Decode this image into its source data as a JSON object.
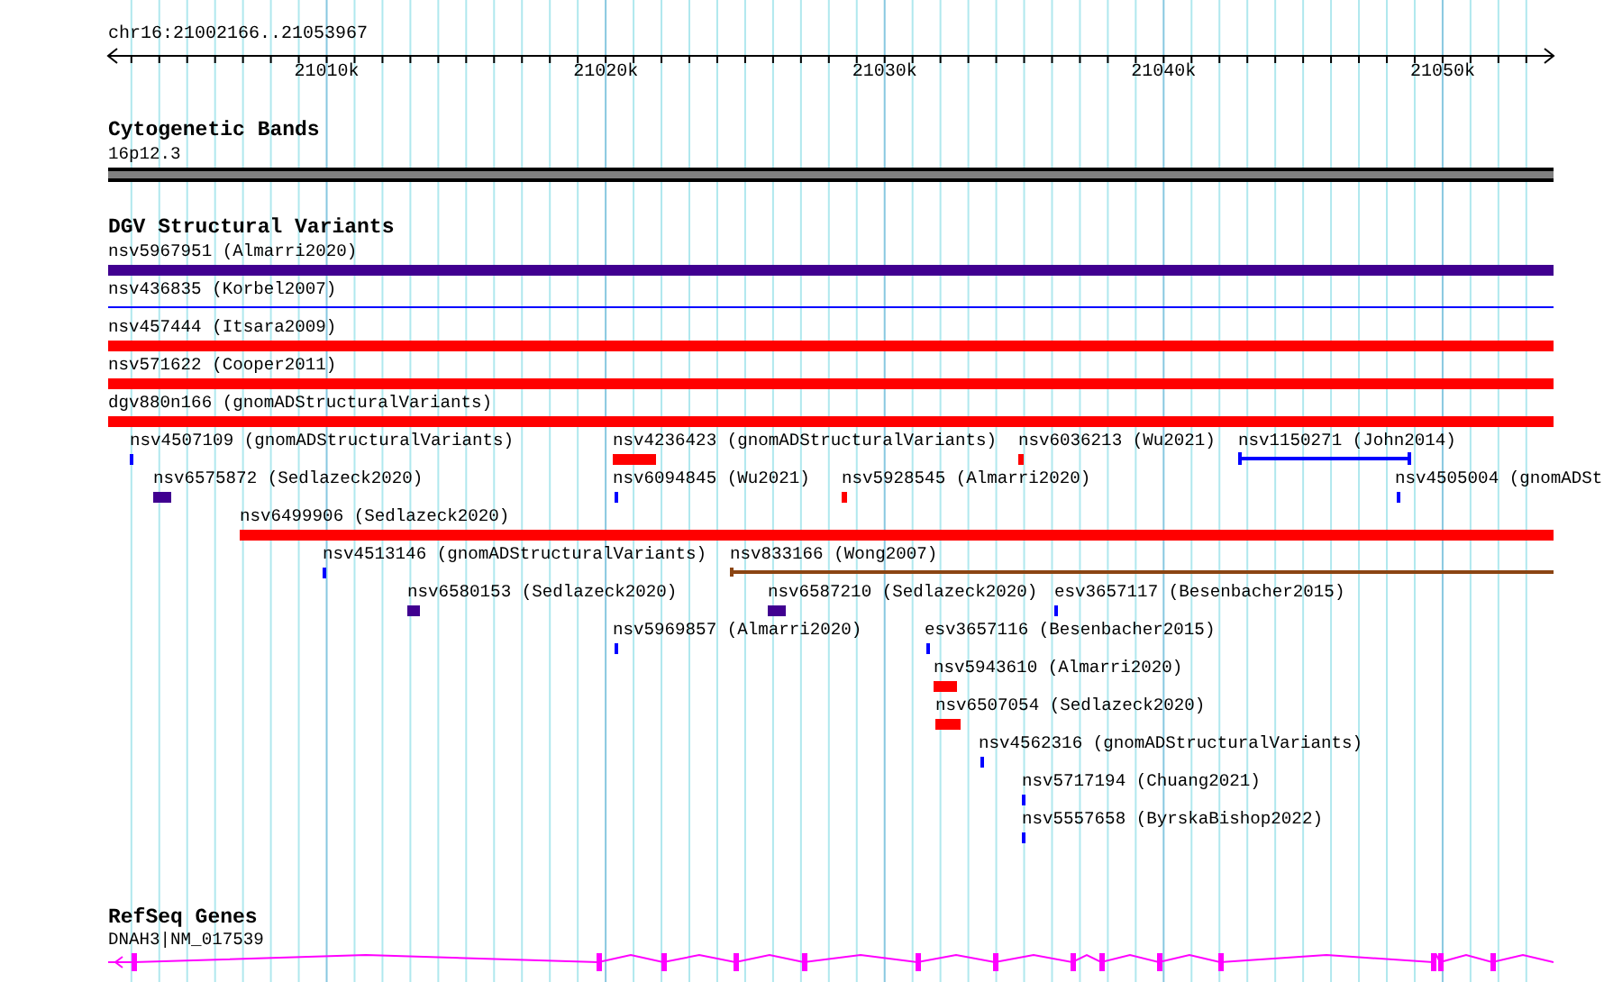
{
  "ruler": {
    "range": "chr16:21002166..21053967",
    "ticks": [
      "21010k",
      "21020k",
      "21030k",
      "21040k",
      "21050k"
    ]
  },
  "tracks": [
    {
      "title": "Cytogenetic Bands",
      "features": [
        {
          "label": "16p12.3",
          "kind": "band"
        }
      ]
    },
    {
      "title": "DGV Structural Variants",
      "features": [
        {
          "label": "nsv5967951 (Almarri2020)",
          "kind": "bar",
          "color": "#400090"
        },
        {
          "label": "nsv436835 (Korbel2007)",
          "kind": "line",
          "color": "#0000ff"
        },
        {
          "label": "nsv457444 (Itsara2009)",
          "kind": "bar",
          "color": "#ff0000"
        },
        {
          "label": "nsv571622 (Cooper2011)",
          "kind": "bar",
          "color": "#ff0000"
        },
        {
          "label": "dgv880n166 (gnomADStructuralVariants)",
          "kind": "bar",
          "color": "#ff0000"
        },
        {
          "label": "nsv4507109 (gnomADStructuralVariants)",
          "kind": "bar",
          "color": "#0000ff"
        },
        {
          "label": "nsv4236423 (gnomADStructuralVariants)",
          "kind": "bar",
          "color": "#ff0000"
        },
        {
          "label": "nsv6036213 (Wu2021)",
          "kind": "bar",
          "color": "#ff0000"
        },
        {
          "label": "nsv1150271 (John2014)",
          "kind": "capped",
          "color": "#0000ff"
        },
        {
          "label": "nsv6575872 (Sedlazeck2020)",
          "kind": "bar",
          "color": "#400090"
        },
        {
          "label": "nsv6094845 (Wu2021)",
          "kind": "bar",
          "color": "#0000ff"
        },
        {
          "label": "nsv5928545 (Almarri2020)",
          "kind": "bar",
          "color": "#ff0000"
        },
        {
          "label": "nsv4505004 (gnomADSt",
          "kind": "bar",
          "color": "#0000ff"
        },
        {
          "label": "nsv6499906 (Sedlazeck2020)",
          "kind": "bar",
          "color": "#ff0000"
        },
        {
          "label": "nsv4513146 (gnomADStructuralVariants)",
          "kind": "bar",
          "color": "#0000ff"
        },
        {
          "label": "nsv833166 (Wong2007)",
          "kind": "startcap",
          "color": "#8b4513"
        },
        {
          "label": "nsv6580153 (Sedlazeck2020)",
          "kind": "bar",
          "color": "#400090"
        },
        {
          "label": "nsv6587210 (Sedlazeck2020)",
          "kind": "bar",
          "color": "#400090"
        },
        {
          "label": "esv3657117 (Besenbacher2015)",
          "kind": "bar",
          "color": "#0000ff"
        },
        {
          "label": "nsv5969857 (Almarri2020)",
          "kind": "bar",
          "color": "#0000ff"
        },
        {
          "label": "esv3657116 (Besenbacher2015)",
          "kind": "bar",
          "color": "#0000ff"
        },
        {
          "label": "nsv5943610 (Almarri2020)",
          "kind": "bar",
          "color": "#ff0000"
        },
        {
          "label": "nsv6507054 (Sedlazeck2020)",
          "kind": "bar",
          "color": "#ff0000"
        },
        {
          "label": "nsv4562316 (gnomADStructuralVariants)",
          "kind": "bar",
          "color": "#0000ff"
        },
        {
          "label": "nsv5717194 (Chuang2021)",
          "kind": "bar",
          "color": "#0000ff"
        },
        {
          "label": "nsv5557658 (ByrskaBishop2022)",
          "kind": "bar",
          "color": "#0000ff"
        }
      ]
    },
    {
      "title": "RefSeq Genes",
      "features": [
        {
          "label": "DNAH3|NM_017539",
          "kind": "gene",
          "color": "#ff00ff"
        }
      ]
    }
  ]
}
